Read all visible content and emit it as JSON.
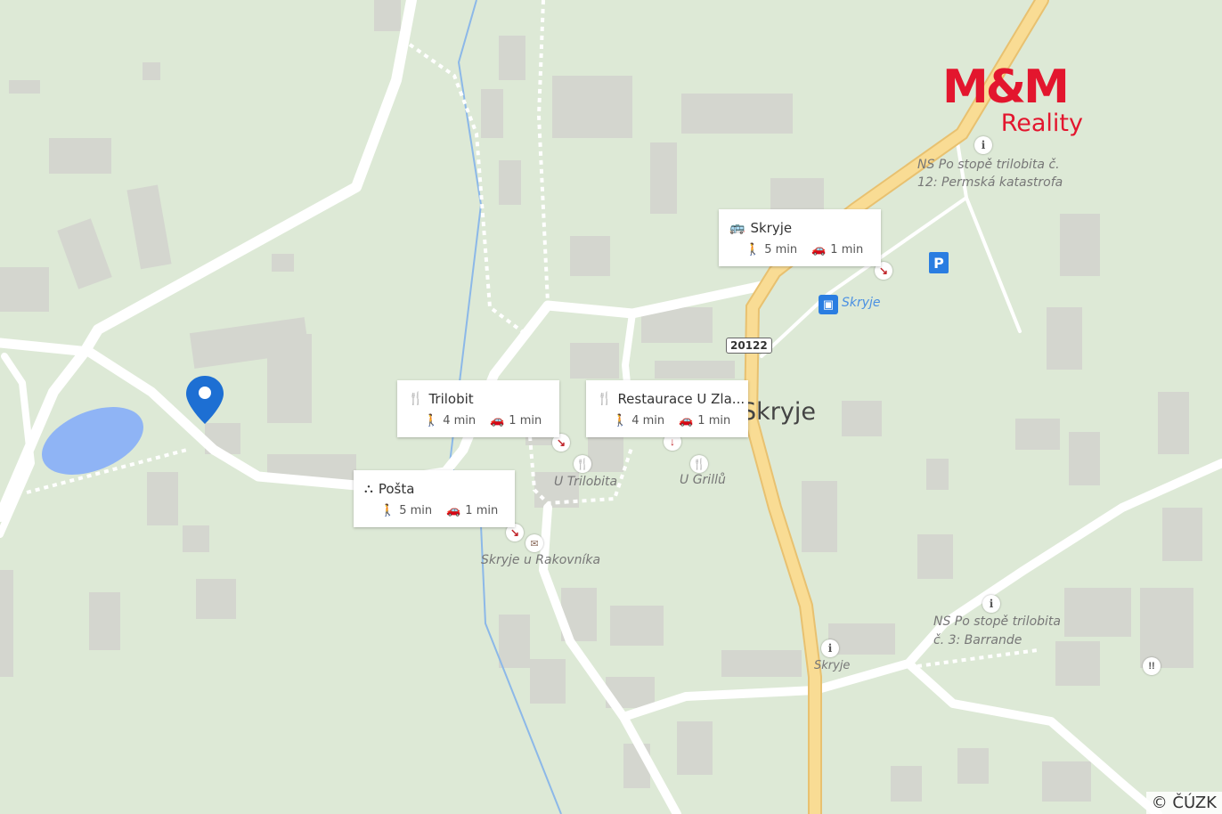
{
  "map": {
    "town_label": "Skryje",
    "road_number": "20122",
    "place_labels": [
      {
        "id": "trilobita-12",
        "text": "NS Po stopě trilobita č.\n12: Permská katastrofa"
      },
      {
        "id": "skryje-bus",
        "text": "Skryje"
      },
      {
        "id": "u-trilobita",
        "text": "U Trilobita"
      },
      {
        "id": "u-grillu",
        "text": "U Grillů"
      },
      {
        "id": "skryje-u-rakovnika",
        "text": "Skryje u Rakovníka"
      },
      {
        "id": "trilobita-3",
        "text": "NS Po stopě trilobita\nč. 3: Barrande"
      },
      {
        "id": "skryje-info",
        "text": "Skryje"
      }
    ],
    "copyright": "© ČÚZK"
  },
  "logo": {
    "mm": "M&M",
    "reality": "Reality"
  },
  "cards": [
    {
      "id": "skryje-stop",
      "title": "Skryje",
      "icon": "bus-icon",
      "walk": "5 min",
      "drive": "1 min"
    },
    {
      "id": "trilobit",
      "title": "Trilobit",
      "icon": "restaurant-icon",
      "walk": "4 min",
      "drive": "1 min"
    },
    {
      "id": "restaurace",
      "title": "Restaurace U Zla...",
      "icon": "restaurant-icon",
      "walk": "4 min",
      "drive": "1 min"
    },
    {
      "id": "posta",
      "title": "Pošta",
      "icon": "post-office-icon",
      "walk": "5 min",
      "drive": "1 min"
    }
  ],
  "colors": {
    "background": "#dde9d6",
    "road": "#ffffff",
    "main_road": "#f7d27a",
    "water": "#8fb4f5",
    "stream": "#8cb8e8",
    "pin": "#1d6fd3",
    "brand": "#e3162e"
  }
}
